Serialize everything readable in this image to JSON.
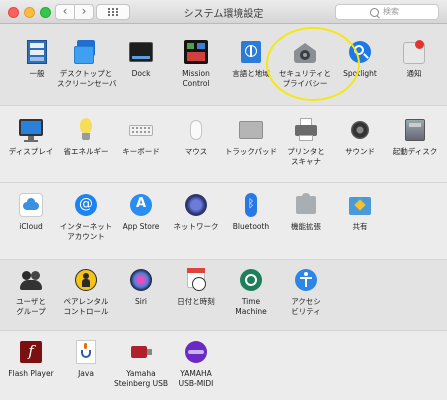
{
  "window": {
    "title": "システム環境設定",
    "search_placeholder": "検索",
    "nav_back": "‹",
    "nav_forward": "›"
  },
  "colors": {
    "highlight": "#f5e70f",
    "section_alt": "#e3e3e3",
    "section_main": "#ececec"
  },
  "rows": [
    [
      {
        "label": "一般",
        "icon": "general-icon"
      },
      {
        "label": "デスクトップと\nスクリーンセーバ",
        "icon": "desktop-screensaver-icon"
      },
      {
        "label": "Dock",
        "icon": "dock-icon"
      },
      {
        "label": "Mission\nControl",
        "icon": "mission-control-icon"
      },
      {
        "label": "言語と地域",
        "icon": "language-region-icon"
      },
      {
        "label": "セキュリティと\nプライバシー",
        "icon": "security-privacy-icon"
      },
      {
        "label": "Spotlight",
        "icon": "spotlight-icon"
      },
      {
        "label": "通知",
        "icon": "notifications-icon"
      }
    ],
    [
      {
        "label": "ディスプレイ",
        "icon": "display-icon"
      },
      {
        "label": "省エネルギー",
        "icon": "energy-saver-icon"
      },
      {
        "label": "キーボード",
        "icon": "keyboard-icon"
      },
      {
        "label": "マウス",
        "icon": "mouse-icon"
      },
      {
        "label": "トラックパッド",
        "icon": "trackpad-icon"
      },
      {
        "label": "プリンタと\nスキャナ",
        "icon": "printer-scanner-icon"
      },
      {
        "label": "サウンド",
        "icon": "sound-icon"
      },
      {
        "label": "起動ディスク",
        "icon": "startup-disk-icon"
      }
    ],
    [
      {
        "label": "iCloud",
        "icon": "icloud-icon"
      },
      {
        "label": "インターネット\nアカウント",
        "icon": "internet-accounts-icon"
      },
      {
        "label": "App Store",
        "icon": "app-store-icon"
      },
      {
        "label": "ネットワーク",
        "icon": "network-icon"
      },
      {
        "label": "Bluetooth",
        "icon": "bluetooth-icon"
      },
      {
        "label": "機能拡張",
        "icon": "extensions-icon"
      },
      {
        "label": "共有",
        "icon": "sharing-icon"
      }
    ],
    [
      {
        "label": "ユーザと\nグループ",
        "icon": "users-groups-icon"
      },
      {
        "label": "ペアレンタル\nコントロール",
        "icon": "parental-controls-icon"
      },
      {
        "label": "Siri",
        "icon": "siri-icon"
      },
      {
        "label": "日付と時刻",
        "icon": "date-time-icon"
      },
      {
        "label": "Time\nMachine",
        "icon": "time-machine-icon"
      },
      {
        "label": "アクセシ\nビリティ",
        "icon": "accessibility-icon"
      }
    ],
    [
      {
        "label": "Flash Player",
        "icon": "flash-player-icon"
      },
      {
        "label": "Java",
        "icon": "java-icon"
      },
      {
        "label": "Yamaha\nSteinberg USB",
        "icon": "yamaha-steinberg-usb-icon"
      },
      {
        "label": "YAMAHA\nUSB-MIDI",
        "icon": "yamaha-usb-midi-icon"
      }
    ]
  ]
}
